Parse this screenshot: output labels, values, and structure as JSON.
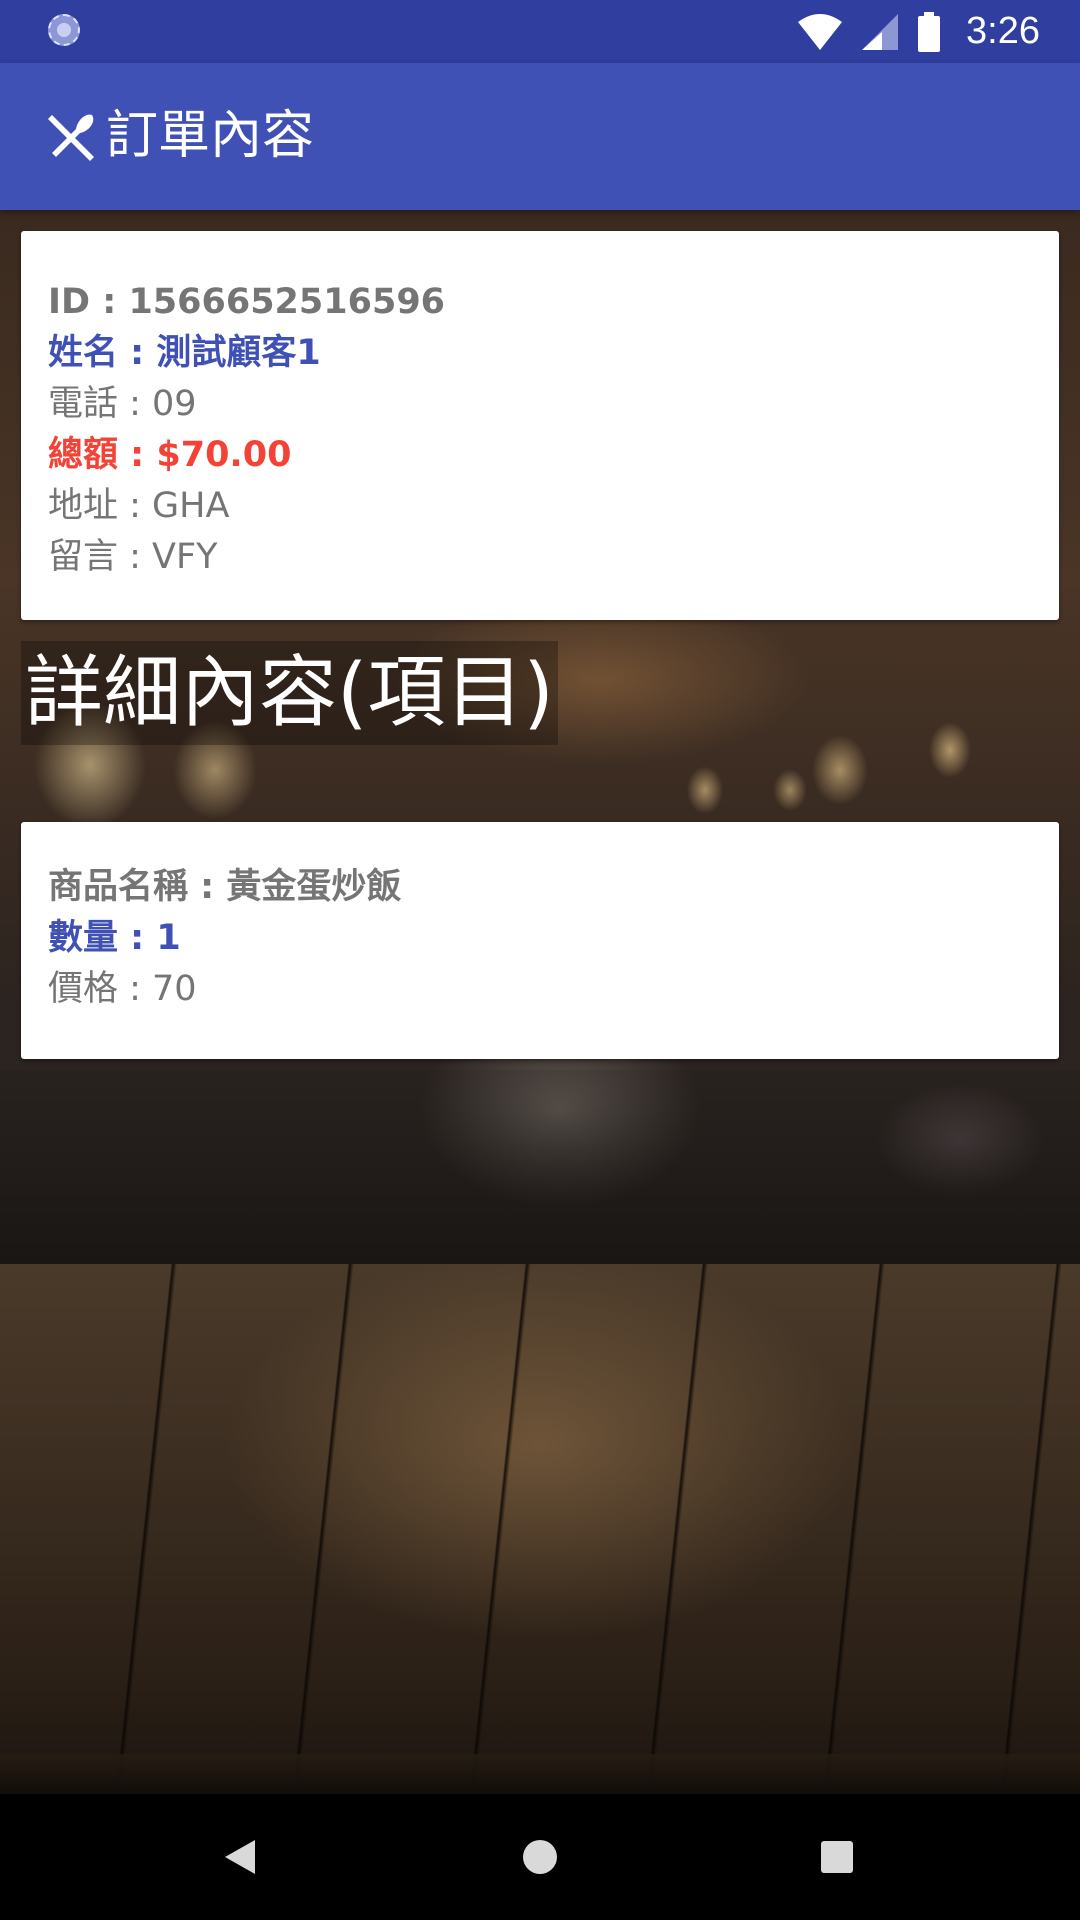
{
  "status_bar": {
    "time": "3:26",
    "icons": [
      "loading-spinner-icon",
      "wifi-icon",
      "cellular-signal-icon",
      "battery-icon"
    ]
  },
  "app_bar": {
    "icon": "fork-knife-icon",
    "title": "訂單內容",
    "color": "#3f51b5"
  },
  "order": {
    "id_line": "ID : 1566652516596",
    "name_line": "姓名 : 測試顧客1",
    "phone_line": "電話 : 09",
    "total_line": "總額 : $70.00",
    "address_line": "地址 : GHA",
    "message_line": "留言 : VFY"
  },
  "section_title": "詳細內容(項目)",
  "items": [
    {
      "name_line": "商品名稱 : 黃金蛋炒飯",
      "quantity_line": "數量 : 1",
      "price_line": "價格 : 70"
    }
  ],
  "colors": {
    "status_bar": "#303f9f",
    "accent_blue": "#3f51b5",
    "total_red": "#f44336",
    "text_gray": "#757575"
  },
  "nav_bar": {
    "icons": [
      "back-icon",
      "home-icon",
      "recents-icon"
    ]
  }
}
